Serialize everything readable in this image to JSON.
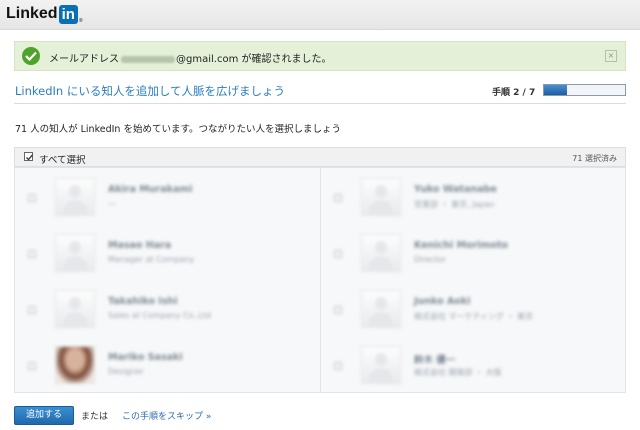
{
  "header": {
    "logo_text": "Linked",
    "logo_in": "in",
    "logo_tm": "®"
  },
  "notice": {
    "message_prefix": "メールアドレス",
    "message_suffix": "@gmail.com が確認されました。",
    "close_label": "×",
    "color": "#e4f1d8"
  },
  "wizard": {
    "title": "LinkedIn にいる知人を追加して人脈を広げましょう",
    "step_label": "手順 2 / 7",
    "step_current": 2,
    "step_total": 7,
    "progress_fraction": 0.2857
  },
  "description": "71 人の知人が LinkedIn を始めています。つながりたい人を選択しましょう",
  "select_all": {
    "label": "すべて選択",
    "checked": true,
    "count_label": "71 選択済み"
  },
  "contacts": [
    {
      "name": "Akira Murakami",
      "subtitle": "—",
      "photo": "placeholder",
      "checked": true
    },
    {
      "name": "Yuko Watanabe",
      "subtitle": "営業部 ・ 東京, Japan",
      "photo": "placeholder",
      "checked": true
    },
    {
      "name": "Masao Hara",
      "subtitle": "Manager at Company",
      "photo": "placeholder",
      "checked": true
    },
    {
      "name": "Kenichi Morimoto",
      "subtitle": "Director",
      "photo": "placeholder",
      "checked": true
    },
    {
      "name": "Takahiko Ishi",
      "subtitle": "Sales at Company Co.,Ltd",
      "photo": "placeholder",
      "checked": true
    },
    {
      "name": "Junko Aoki",
      "subtitle": "株式会社 マーケティング ・ 東京",
      "photo": "placeholder",
      "checked": true
    },
    {
      "name": "Mariko Sasaki",
      "subtitle": "Designer",
      "photo": "photo",
      "checked": true
    },
    {
      "name": "鈴木 優一",
      "subtitle": "株式会社 開発部 ・ 大阪",
      "photo": "placeholder",
      "checked": true
    }
  ],
  "footer": {
    "add_button": "追加する",
    "or_text": "または",
    "skip_link": "この手順をスキップ »"
  },
  "colors": {
    "accent": "#2a7ec1",
    "button": "#1f69ad",
    "success": "#4ea32a"
  }
}
